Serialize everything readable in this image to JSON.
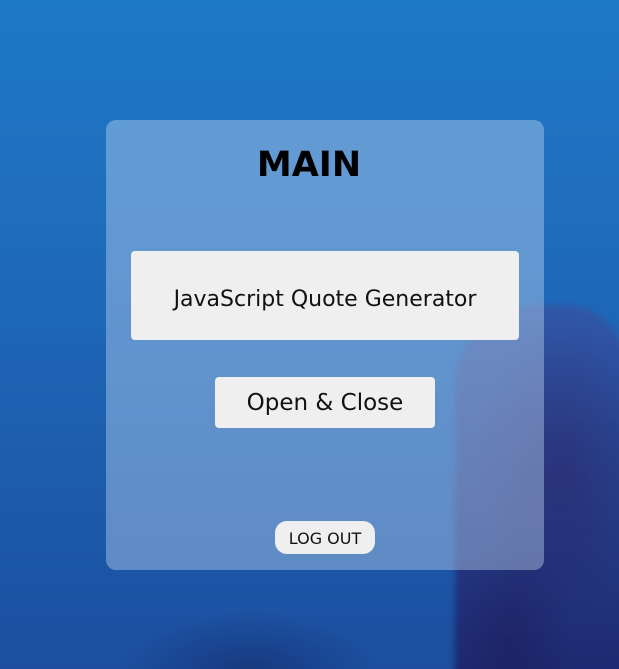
{
  "page": {
    "title": "MAIN"
  },
  "buttons": {
    "quote_generator_label": "JavaScript Quote Generator",
    "open_close_label": "Open & Close",
    "logout_label": "LOG OUT"
  },
  "colors": {
    "background_top": "#1e79c6",
    "background_bottom": "#1c4fa0",
    "button_bg": "#efefef",
    "title_text": "#000000"
  }
}
